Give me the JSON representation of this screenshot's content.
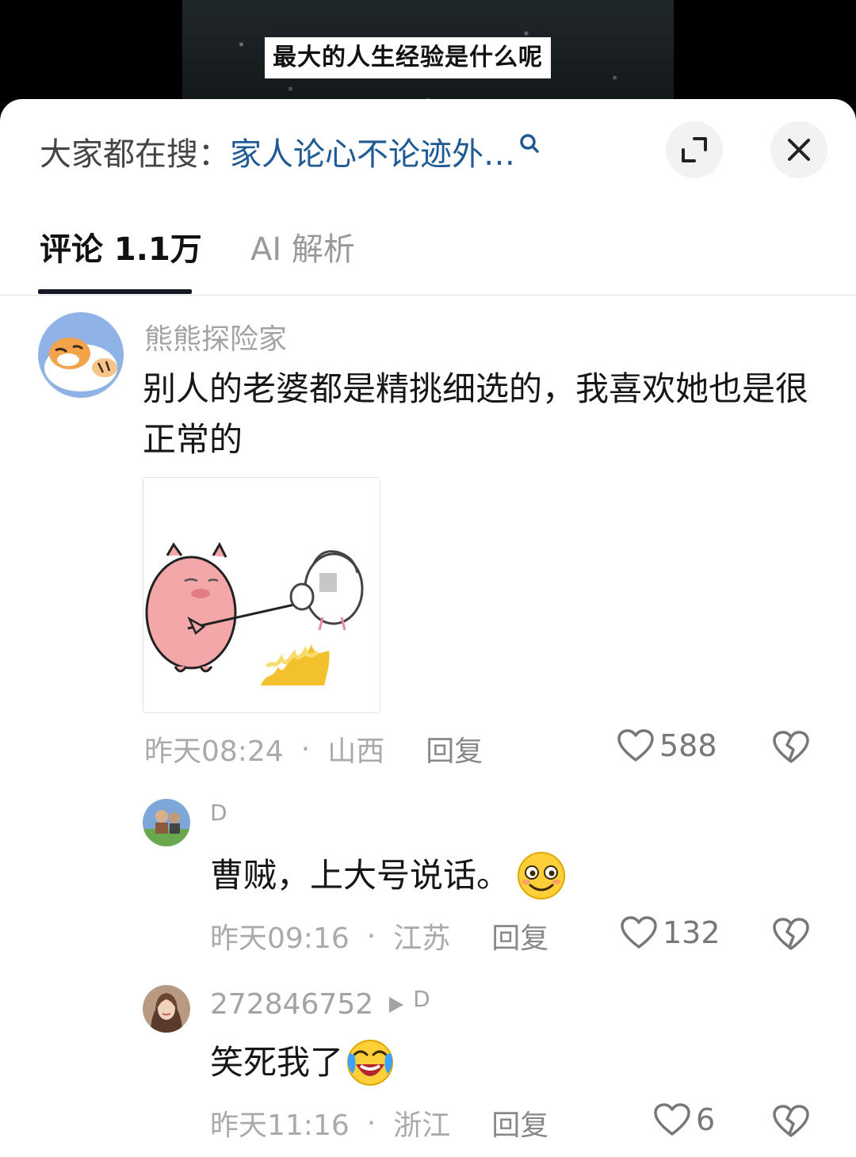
{
  "video": {
    "caption": "最大的人生经验是什么呢"
  },
  "search": {
    "prefix": "大家都在搜：",
    "query": "家人论心不论迹外…"
  },
  "tabs": [
    {
      "label": "评论 1.1万",
      "active": true
    },
    {
      "label": "AI 解析",
      "active": false
    }
  ],
  "comments": [
    {
      "username": "熊熊探险家",
      "text": "别人的老婆都是精挑细选的，我喜欢她也是很正常的",
      "has_sticker": true,
      "time": "昨天08:24",
      "location": "山西",
      "reply_label": "回复",
      "likes": "588"
    },
    {
      "username": "D",
      "text": "曹贼，上大号说话。",
      "emoji": "smile-emoji",
      "time": "昨天09:16",
      "location": "江苏",
      "reply_label": "回复",
      "likes": "132"
    },
    {
      "username": "272846752",
      "reply_to": "D",
      "text": "笑死我了",
      "emoji": "laughing-crying-emoji",
      "time": "昨天11:16",
      "location": "浙江",
      "reply_label": "回复",
      "likes": "6"
    }
  ],
  "meta_separator": "·",
  "colors": {
    "link": "#1f5a94",
    "muted": "#a3a3a3",
    "tab_underline": "#161823"
  }
}
